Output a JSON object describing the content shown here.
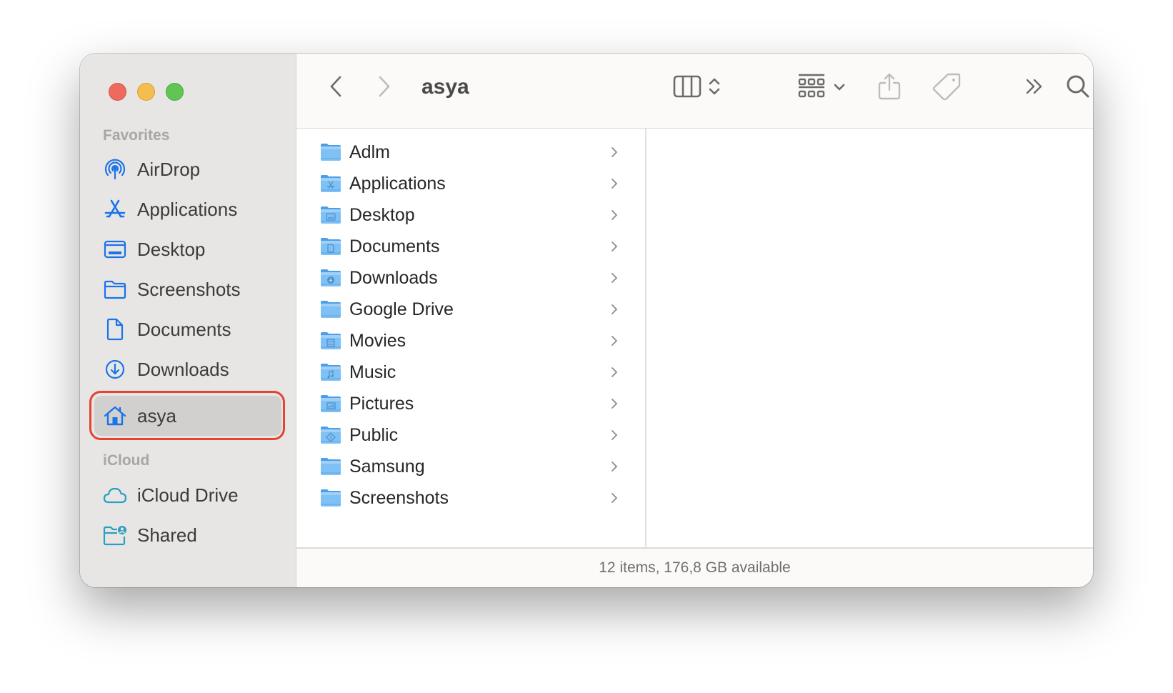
{
  "window": {
    "title": "asya",
    "traffic_lights": [
      "close",
      "minimize",
      "zoom"
    ]
  },
  "sidebar": {
    "sections": [
      {
        "label": "Favorites",
        "items": [
          {
            "label": "AirDrop",
            "icon": "airdrop-icon"
          },
          {
            "label": "Applications",
            "icon": "applications-icon"
          },
          {
            "label": "Desktop",
            "icon": "desktop-icon"
          },
          {
            "label": "Screenshots",
            "icon": "folder-icon"
          },
          {
            "label": "Documents",
            "icon": "document-icon"
          },
          {
            "label": "Downloads",
            "icon": "download-icon"
          },
          {
            "label": "asya",
            "icon": "home-icon",
            "selected": true
          }
        ]
      },
      {
        "label": "iCloud",
        "items": [
          {
            "label": "iCloud Drive",
            "icon": "cloud-icon"
          },
          {
            "label": "Shared",
            "icon": "shared-folder-icon"
          }
        ]
      }
    ]
  },
  "toolbar": {
    "back": "chevron-left-icon",
    "forward": "chevron-right-icon",
    "title": "asya",
    "view": "column-view-icon",
    "group": "group-icon",
    "share": "share-icon",
    "tags": "tag-icon",
    "more": "double-chevron-icon",
    "search": "search-icon"
  },
  "files": [
    {
      "name": "Adlm",
      "glyph": ""
    },
    {
      "name": "Applications",
      "glyph": "A"
    },
    {
      "name": "Desktop",
      "glyph": "desk"
    },
    {
      "name": "Documents",
      "glyph": "doc"
    },
    {
      "name": "Downloads",
      "glyph": "down"
    },
    {
      "name": "Google Drive",
      "glyph": ""
    },
    {
      "name": "Movies",
      "glyph": "film"
    },
    {
      "name": "Music",
      "glyph": "note"
    },
    {
      "name": "Pictures",
      "glyph": "pic"
    },
    {
      "name": "Public",
      "glyph": "pub"
    },
    {
      "name": "Samsung",
      "glyph": ""
    },
    {
      "name": "Screenshots",
      "glyph": ""
    }
  ],
  "status": {
    "text": "12 items, 176,8 GB available"
  },
  "colors": {
    "accent": "#1a73e8",
    "icloud": "#2aa0c0",
    "highlight": "#e5432f"
  }
}
